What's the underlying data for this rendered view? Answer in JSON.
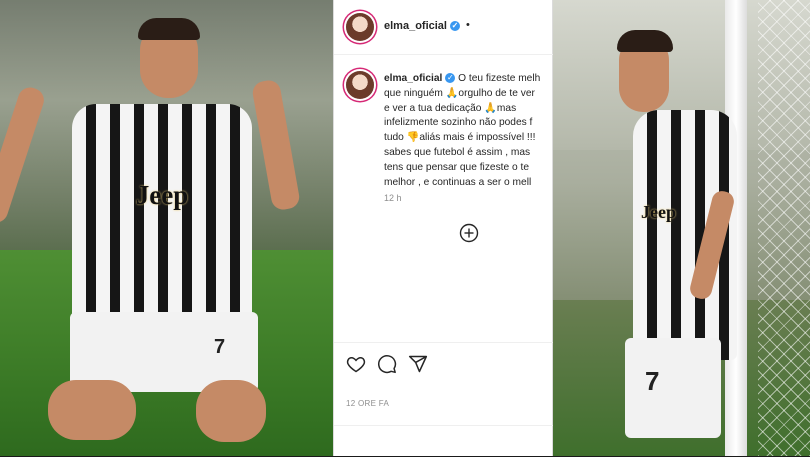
{
  "post": {
    "username": "elma_oficial",
    "more_dot": "•",
    "comment_username": "elma_oficial",
    "comment_lines": [
      "O teu fizeste melh",
      "que ninguém 🙏orgulho de te ver",
      "e ver a tua dedicação 🙏mas",
      "infelizmente sozinho não podes f",
      "tudo 👎aliás mais é impossível !!!",
      "sabes que futebol é assim , mas",
      "tens que pensar que fizeste o te",
      "melhor , e continuas a ser o mell"
    ],
    "comment_time": "12 h",
    "timestamp": "12 ORE FA"
  },
  "left_photo": {
    "sponsor": "Jeep",
    "number": "7"
  },
  "right_photo": {
    "sponsor": "Jeep",
    "number": "7"
  },
  "colors": {
    "verified": "#3897f0",
    "text": "#262626",
    "muted": "#8e8e8e"
  },
  "icons": [
    "verified-badge-icon",
    "add-comment-icon",
    "heart-icon",
    "comment-icon",
    "share-icon"
  ]
}
